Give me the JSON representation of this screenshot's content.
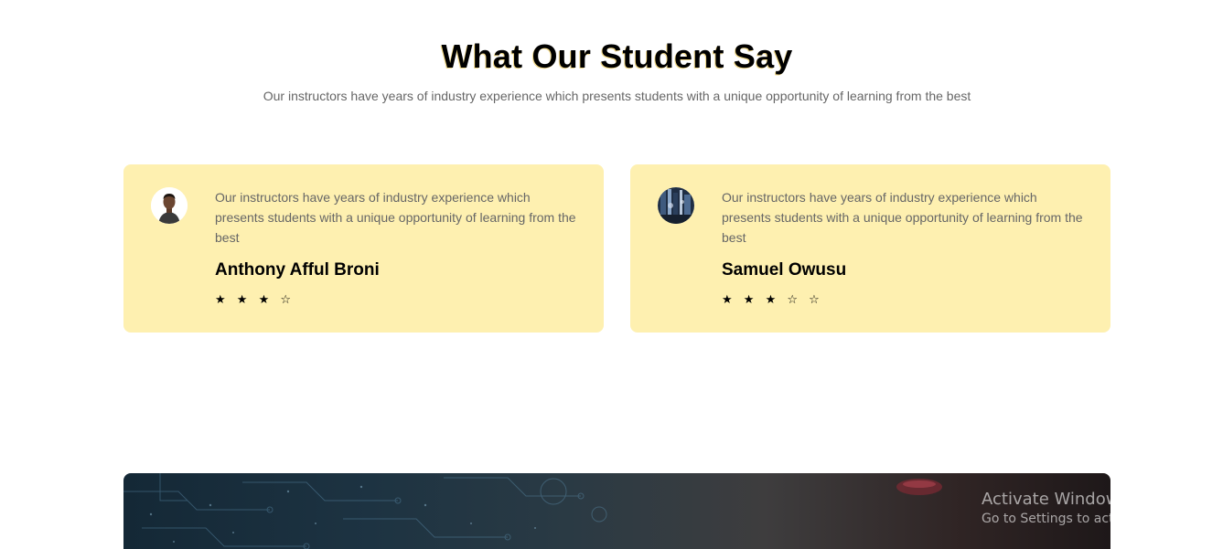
{
  "section": {
    "title": "What Our Student Say",
    "subtitle": "Our instructors have years of industry experience which presents students with a unique opportunity of learning from the best"
  },
  "testimonials": [
    {
      "quote": "Our instructors have years of industry experience which presents students with a unique opportunity of learning from the best",
      "name": "Anthony Afful Broni",
      "stars": "★ ★ ★ ☆",
      "rating": 3,
      "rating_max": 4
    },
    {
      "quote": "Our instructors have years of industry experience which presents students with a unique opportunity of learning from the best",
      "name": "Samuel Owusu",
      "stars": "★ ★ ★ ☆ ☆",
      "rating": 3,
      "rating_max": 5
    }
  ],
  "watermark": {
    "title": "Activate Windows",
    "subtitle": "Go to Settings to activate Windows."
  },
  "colors": {
    "card_background": "#fef0b0",
    "title_shadow": "#f2d98a",
    "body_text": "#666666"
  }
}
